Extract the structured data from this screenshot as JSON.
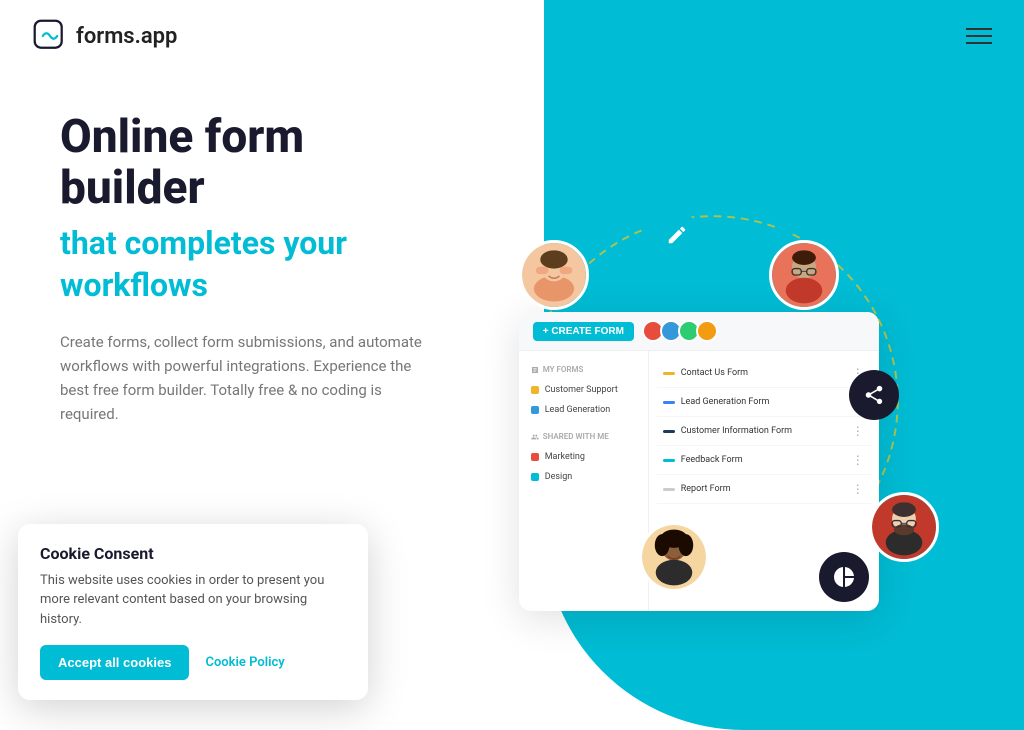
{
  "brand": {
    "name": "forms.app",
    "logo_alt": "forms app logo"
  },
  "header": {
    "menu_icon_alt": "hamburger menu"
  },
  "hero": {
    "headline_line1": "Online form",
    "headline_line2": "builder",
    "headline_accent": "that completes your workflows",
    "description": "Create forms, collect form submissions, and automate workflows with powerful integrations. Experience the best free form builder. Totally free & no coding is required."
  },
  "mockup": {
    "create_btn": "+ CREATE FORM",
    "my_forms_label": "MY FORMS",
    "sidebar_items": [
      {
        "label": "Customer Support",
        "color": "yellow"
      },
      {
        "label": "Lead Generation",
        "color": "blue"
      }
    ],
    "shared_label": "SHARED WITH ME",
    "shared_items": [
      {
        "label": "Marketing",
        "color": "red"
      },
      {
        "label": "Design",
        "color": "teal"
      }
    ],
    "form_items": [
      {
        "label": "Contact Us Form",
        "bar_color": "yellow"
      },
      {
        "label": "Lead Generation Form",
        "bar_color": "blue"
      },
      {
        "label": "Customer Information Form",
        "bar_color": "navy"
      },
      {
        "label": "Feedback Form",
        "bar_color": "teal"
      },
      {
        "label": "Report Form",
        "bar_color": "gray"
      }
    ]
  },
  "icons": {
    "edit": "✏",
    "share": "⟨",
    "chart": "◔"
  },
  "cookie": {
    "title": "Cookie Consent",
    "description": "This website uses cookies in order to present you more relevant content based on your browsing history.",
    "accept_label": "Accept all cookies",
    "policy_label": "Cookie Policy"
  },
  "colors": {
    "teal": "#00bcd4",
    "dark": "#1a1a2e",
    "yellow": "#f5c518"
  }
}
